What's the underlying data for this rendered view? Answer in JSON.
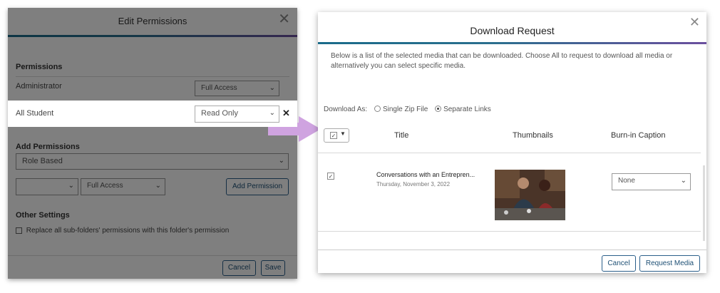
{
  "edit_permissions": {
    "title": "Edit Permissions",
    "permissions_heading": "Permissions",
    "rows": [
      {
        "name": "Administrator",
        "access": "Full Access"
      },
      {
        "name": "All Student",
        "access": "Read Only"
      }
    ],
    "add_permissions_heading": "Add Permissions",
    "type_select": "Role Based",
    "role_select": "",
    "access_select": "Full Access",
    "add_button": "Add Permission",
    "other_settings_heading": "Other Settings",
    "replace_label": "Replace all sub-folders' permissions with this folder's permission",
    "cancel": "Cancel",
    "save": "Save"
  },
  "download_request": {
    "title": "Download Request",
    "intro": "Below is a list of the selected media that can be downloaded. Choose All to request to download all media or alternatively you can select specific media.",
    "download_as_label": "Download As:",
    "option_zip": "Single Zip File",
    "option_links": "Separate Links",
    "selected_option": "Separate Links",
    "columns": {
      "title": "Title",
      "thumbnails": "Thumbnails",
      "caption": "Burn-in Caption"
    },
    "media": [
      {
        "title": "Conversations with an Entrepren...",
        "date": "Thursday, November 3, 2022",
        "caption": "None",
        "checked": true
      }
    ],
    "cancel": "Cancel",
    "request": "Request Media"
  },
  "icons": {
    "close": "close-icon",
    "chevron": "chevron-down-icon",
    "remove": "remove-x-icon",
    "arrow": "right-arrow-icon"
  },
  "colors": {
    "accent": "#2b5f8a",
    "gradient_start": "#1a6b8a",
    "gradient_end": "#6b4f9e",
    "arrow": "#cfa3e0"
  }
}
